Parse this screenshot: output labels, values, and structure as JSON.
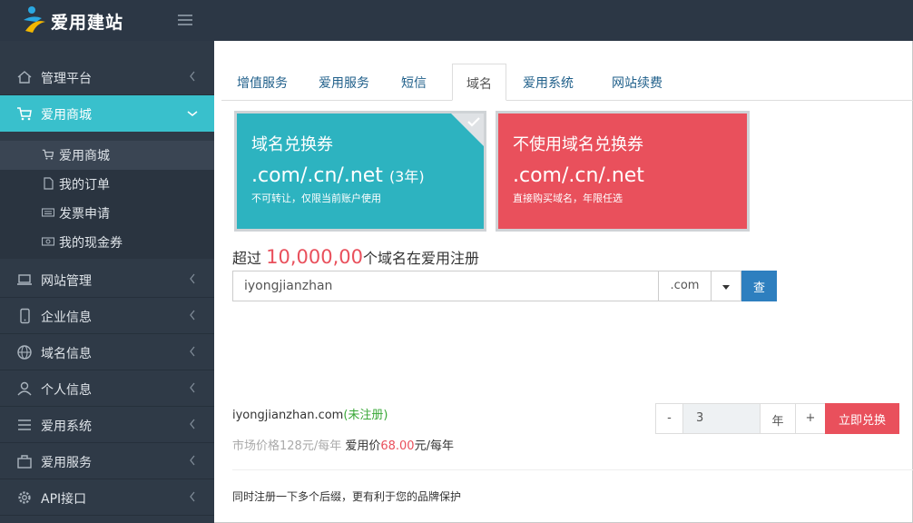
{
  "app": {
    "brand": "爱用建站"
  },
  "sidebar": {
    "items": [
      {
        "label": "管理平台",
        "icon": "home-icon"
      },
      {
        "label": "爱用商城",
        "icon": "cart-icon"
      },
      {
        "label": "网站管理",
        "icon": "laptop-icon"
      },
      {
        "label": "企业信息",
        "icon": "phone-icon"
      },
      {
        "label": "域名信息",
        "icon": "globe-icon"
      },
      {
        "label": "个人信息",
        "icon": "user-icon"
      },
      {
        "label": "爱用系统",
        "icon": "list-icon"
      },
      {
        "label": "爱用服务",
        "icon": "briefcase-icon"
      },
      {
        "label": "API接口",
        "icon": "gear-icon"
      }
    ],
    "sub_items": [
      {
        "label": "爱用商城",
        "icon": "cart-icon"
      },
      {
        "label": "我的订单",
        "icon": "document-icon"
      },
      {
        "label": "发票申请",
        "icon": "keyboard-icon"
      },
      {
        "label": "我的现金券",
        "icon": "cash-icon"
      }
    ]
  },
  "tabs": [
    {
      "label": "增值服务"
    },
    {
      "label": "爱用服务"
    },
    {
      "label": "短信"
    },
    {
      "label": "域名"
    },
    {
      "label": "爱用系统"
    },
    {
      "label": "网站续费"
    }
  ],
  "cards": {
    "voucher": {
      "title": "域名兑换券",
      "domains": ".com/.cn/.net",
      "years": "(3年)",
      "desc": "不可转让，仅限当前账户使用"
    },
    "no_voucher": {
      "title": "不使用域名兑换券",
      "domains": ".com/.cn/.net",
      "desc": "直接购买域名，年限任选"
    }
  },
  "headline": {
    "prefix": "超过 ",
    "count": "10,000,00",
    "suffix": "个域名在爱用注册"
  },
  "search": {
    "value": "iyongjianzhan",
    "tld": ".com",
    "button": "查"
  },
  "result": {
    "domain": "iyongjianzhan.com",
    "status": "(未注册)"
  },
  "price": {
    "market": "市场价格128元/每年",
    "label": "爱用价",
    "value": "68.00",
    "unit": "元/每年"
  },
  "purchase": {
    "minus": "-",
    "years": "3",
    "years_unit": "年",
    "plus": "+",
    "redeem": "立即兑换"
  },
  "footnote": "同时注册一下多个后缀，更有利于您的品牌保护",
  "colors": {
    "teal": "#2db3c0",
    "red": "#e9505c",
    "sidebar": "#2f3a47",
    "active": "#39c0cc",
    "button_blue": "#2e7fbf",
    "available": "#39a837"
  }
}
